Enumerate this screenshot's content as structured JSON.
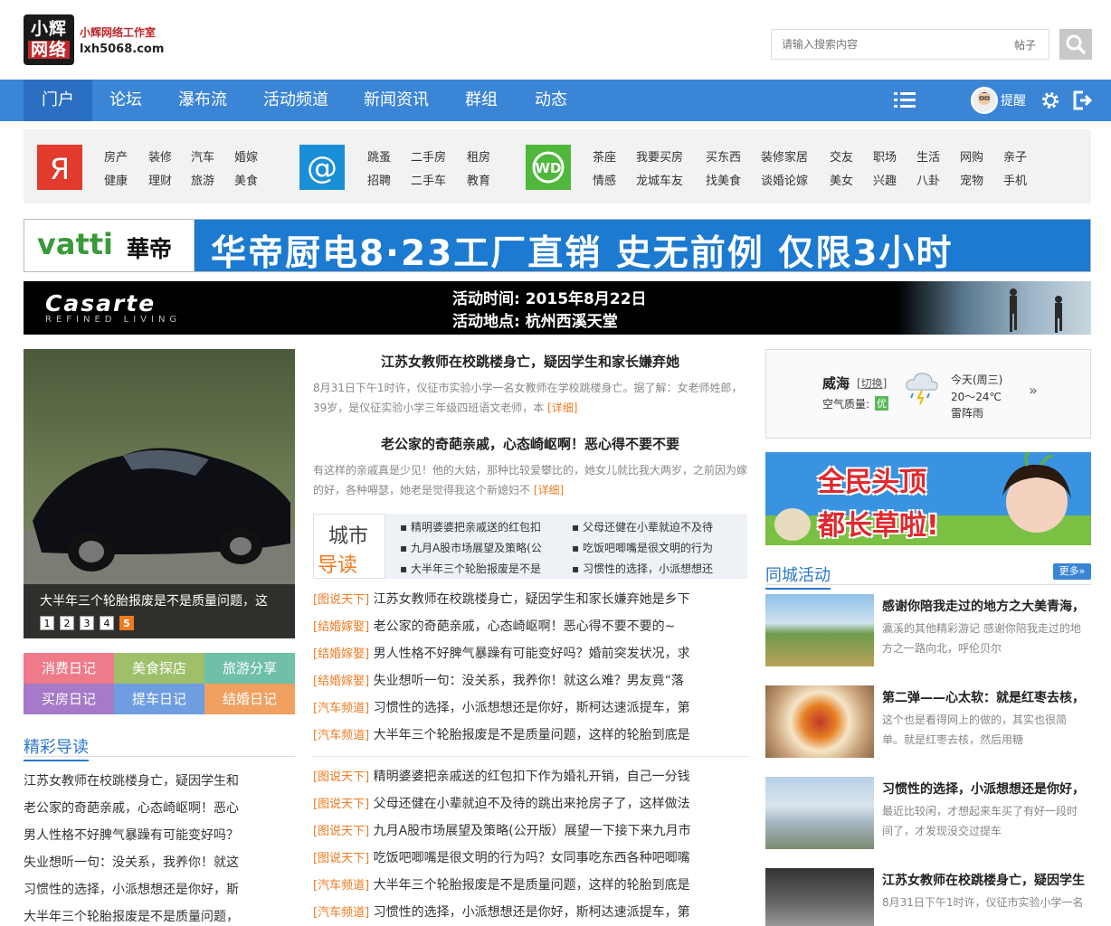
{
  "header": {
    "logo_line1": "小辉",
    "logo_line2": "网络",
    "studio": "小辉网络工作室",
    "domain": "lxh5068.com",
    "search_placeholder": "请输入搜索内容",
    "search_type": "帖子"
  },
  "nav": {
    "items": [
      "门户",
      "论坛",
      "瀑布流",
      "活动频道",
      "新闻资讯",
      "群组",
      "动态"
    ],
    "remind": "提醒"
  },
  "categories": {
    "group1": [
      [
        "房产",
        "装修",
        "汽车",
        "婚嫁"
      ],
      [
        "健康",
        "理财",
        "旅游",
        "美食"
      ]
    ],
    "group2": [
      [
        "跳蚤",
        "二手房",
        "租房"
      ],
      [
        "招聘",
        "二手车",
        "教育"
      ]
    ],
    "group3": [
      [
        "茶座",
        "我要买房",
        "买东西",
        "装修家居",
        "交友",
        "职场",
        "生活",
        "网购",
        "亲子"
      ],
      [
        "情感",
        "龙城车友",
        "找美食",
        "谈婚论嫁",
        "美女",
        "兴趣",
        "八卦",
        "宠物",
        "手机"
      ]
    ]
  },
  "banners": {
    "vatti_brand": "vatti",
    "vatti_cn": "華帝",
    "vatti_text": "华帝厨电8·23工厂直销 史无前例 仅限3小时",
    "casarte_brand": "Casarte",
    "casarte_sub": "REFINED LIVING",
    "casarte_time": "活动时间: 2015年8月22日",
    "casarte_place": "活动地点: 杭州西溪天堂"
  },
  "slider": {
    "caption": "大半年三个轮胎报废是不是质量问题，这",
    "pages": [
      "1",
      "2",
      "3",
      "4",
      "5"
    ],
    "active_page": "5"
  },
  "diary": [
    {
      "label": "消费日记",
      "color": "#ef7a8a"
    },
    {
      "label": "美食探店",
      "color": "#9fbf6a"
    },
    {
      "label": "旅游分享",
      "color": "#6fbfa9"
    },
    {
      "label": "买房日记",
      "color": "#a67ac8"
    },
    {
      "label": "提车日记",
      "color": "#6e9de0"
    },
    {
      "label": "结婚日记",
      "color": "#f0a060"
    }
  ],
  "jingcai": {
    "title": "精彩导读",
    "items": [
      "江苏女教师在校跳楼身亡，疑因学生和",
      "老公家的奇葩亲戚，心态崎岖啊！恶心",
      "男人性格不好脾气暴躁有可能变好吗？",
      "失业想听一句：没关系，我养你！就这",
      "习惯性的选择，小派想想还是你好，斯",
      "大半年三个轮胎报废是不是质量问题，"
    ]
  },
  "headlines": [
    {
      "title": "江苏女教师在校跳楼身亡，疑因学生和家长嫌弃她",
      "desc": "8月31日下午1时许，仪征市实验小学一名女教师在学校跳楼身亡。据了解：女老师姓郎，39岁，是仪征实验小学三年级四班语文老师，本",
      "more": "[详细]"
    },
    {
      "title": "老公家的奇葩亲戚，心态崎岖啊！恶心得不要不要",
      "desc": "有这样的亲戚真是少见！他的大姑，那种比较爱攀比的，她女儿就比我大两岁，之前因为嫁的好，各种嘚瑟，她老是觉得我这个新媳妇不",
      "more": "[详细]"
    }
  ],
  "city": {
    "label1": "城市",
    "label2": "导读",
    "col1": [
      "精明婆婆把亲戚送的红包扣",
      "九月A股市场展望及策略(公",
      "大半年三个轮胎报废是不是"
    ],
    "col2": [
      "父母还健在小辈就迫不及待",
      "吃饭吧唧嘴是很文明的行为",
      "习惯性的选择，小派想想还"
    ]
  },
  "news1": [
    {
      "tag": "[图说天下]",
      "text": "江苏女教师在校跳楼身亡，疑因学生和家长嫌弃她是乡下"
    },
    {
      "tag": "[结婚嫁娶]",
      "text": "老公家的奇葩亲戚，心态崎岖啊！恶心得不要不要的~"
    },
    {
      "tag": "[结婚嫁娶]",
      "text": "男人性格不好脾气暴躁有可能变好吗？婚前突发状况，求"
    },
    {
      "tag": "[结婚嫁娶]",
      "text": "失业想听一句：没关系，我养你！就这么难？男友竟“落"
    },
    {
      "tag": "[汽车频道]",
      "text": "习惯性的选择，小派想想还是你好，斯柯达速派提车，第"
    },
    {
      "tag": "[汽车频道]",
      "text": "大半年三个轮胎报废是不是质量问题，这样的轮胎到底是"
    }
  ],
  "news2": [
    {
      "tag": "[图说天下]",
      "text": "精明婆婆把亲戚送的红包扣下作为婚礼开销，自己一分钱"
    },
    {
      "tag": "[图说天下]",
      "text": "父母还健在小辈就迫不及待的跳出来抢房子了，这样做法"
    },
    {
      "tag": "[图说天下]",
      "text": "九月A股市场展望及策略(公开版）展望一下接下来九月市"
    },
    {
      "tag": "[图说天下]",
      "text": "吃饭吧唧嘴是很文明的行为吗？女同事吃东西各种吧唧嘴"
    },
    {
      "tag": "[汽车频道]",
      "text": "大半年三个轮胎报废是不是质量问题，这样的轮胎到底是"
    },
    {
      "tag": "[汽车频道]",
      "text": "习惯性的选择，小派想想还是你好，斯柯达速派提车，第"
    }
  ],
  "weather": {
    "city": "威海",
    "switch": "[切换]",
    "aq_label": "空气质量:",
    "aq_value": "优",
    "day": "今天(周三)",
    "temp": "20～24℃",
    "cond": "雷阵雨"
  },
  "ad_right": {
    "line1": "全民头顶",
    "line2": "都长草啦!"
  },
  "activities": {
    "title": "同城活动",
    "more": "更多»",
    "items": [
      {
        "title": "感谢你陪我走过的地方之大美青海，",
        "desc": "瀛溪的其他精彩游记 感谢你陪我走过的地方之一路向北，呼伦贝尔"
      },
      {
        "title": "第二弹——心太软：就是红枣去核，",
        "desc": "这个也是看得网上的做的，其实也很简单。就是红枣去核，然后用糖"
      },
      {
        "title": "习惯性的选择，小派想想还是你好，",
        "desc": "最近比较闲，才想起来车买了有好一段时间了，才发现没交过提车"
      },
      {
        "title": "江苏女教师在校跳楼身亡，疑因学生",
        "desc": "8月31日下午1时许，仪征市实验小学一名"
      }
    ]
  }
}
